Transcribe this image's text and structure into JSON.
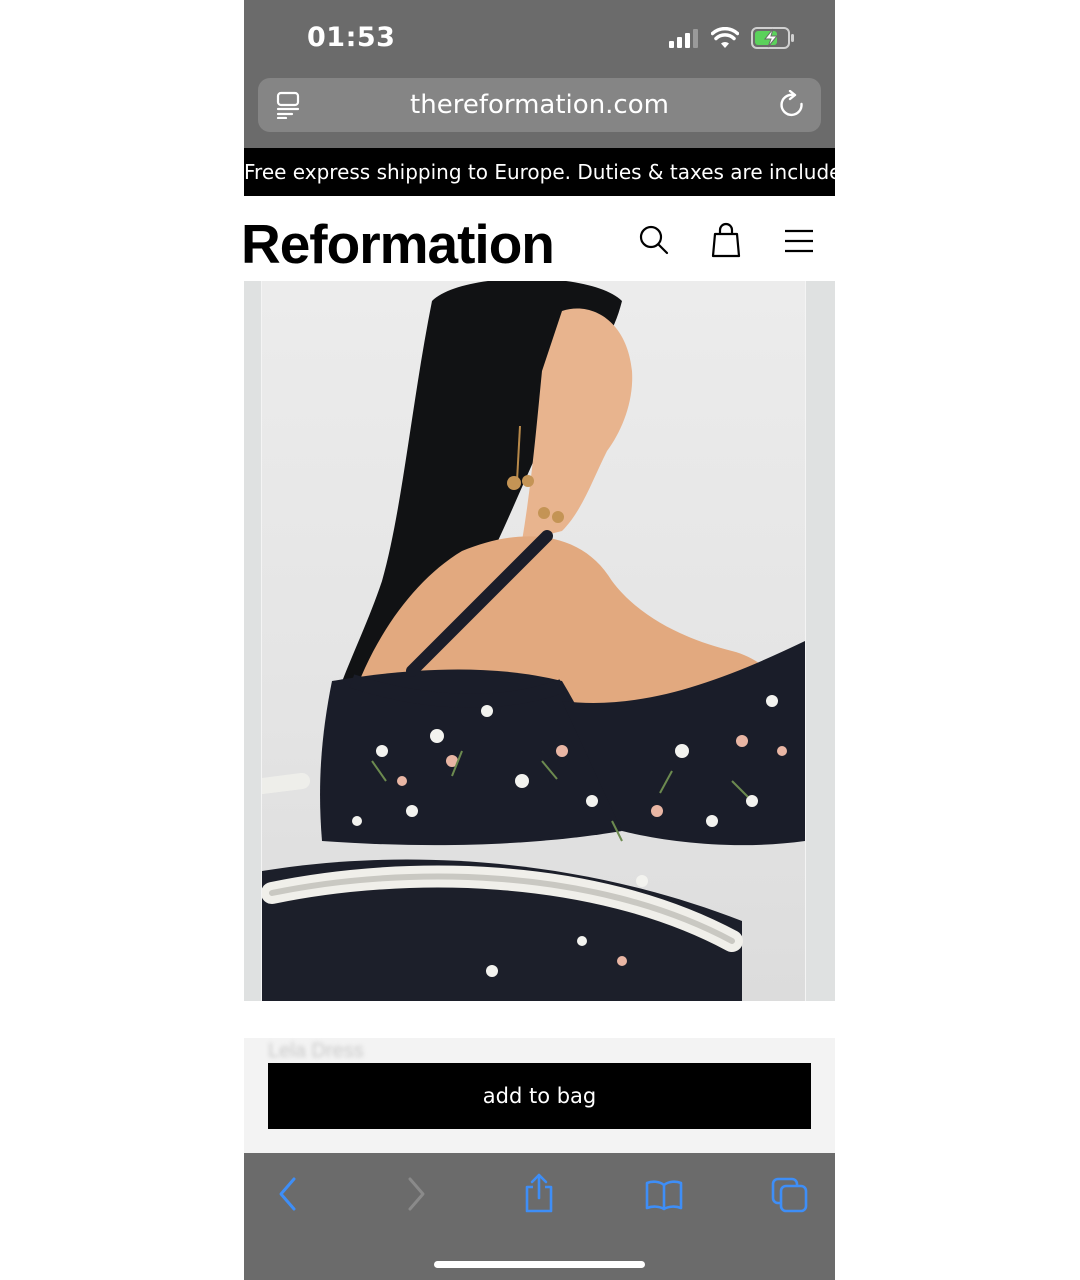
{
  "status_bar": {
    "time": "01:53"
  },
  "browser": {
    "url": "thereformation.com"
  },
  "promo": {
    "text": "Free express shipping to Europe. Duties & taxes are included."
  },
  "header": {
    "logo": "Reformation"
  },
  "product": {
    "name": "Lela Dress",
    "add_to_bag_label": "add to bag"
  },
  "colors": {
    "chrome": "#6b6b6b",
    "accent_blue": "#3e8ef7",
    "banner": "#000000"
  },
  "icons": {
    "status": [
      "signal-icon",
      "wifi-icon",
      "battery-charging-icon"
    ],
    "url_bar": [
      "reader-icon",
      "reload-icon"
    ],
    "header": [
      "search-icon",
      "bag-icon",
      "menu-icon"
    ],
    "toolbar": [
      "back-icon",
      "forward-icon",
      "share-icon",
      "bookmarks-icon",
      "tabs-icon"
    ]
  }
}
